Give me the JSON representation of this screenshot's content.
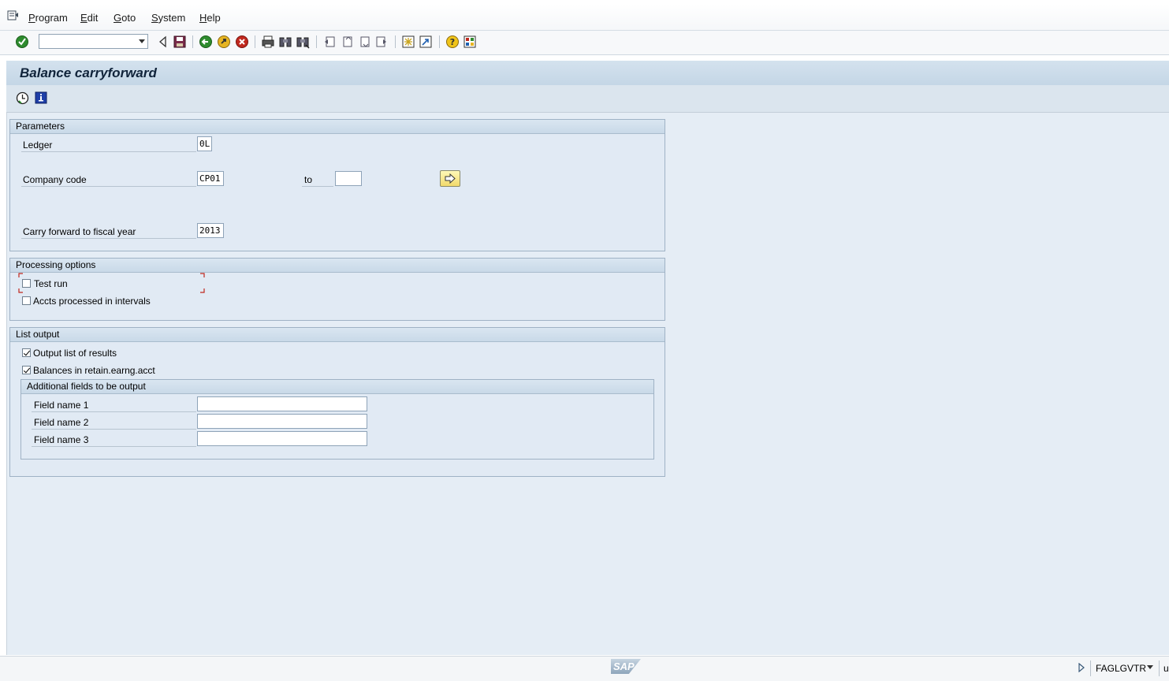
{
  "menu": {
    "items": [
      "Program",
      "Edit",
      "Goto",
      "System",
      "Help"
    ]
  },
  "toolbar": {
    "command_field_value": ""
  },
  "page": {
    "title": "Balance carryforward"
  },
  "parameters": {
    "title": "Parameters",
    "ledger_label": "Ledger",
    "ledger_value": "0L",
    "company_code_label": "Company code",
    "company_code_value": "CP01",
    "to_label": "to",
    "company_code_to_value": "",
    "fiscal_year_label": "Carry forward to fiscal year",
    "fiscal_year_value": "2013"
  },
  "processing": {
    "title": "Processing options",
    "test_run_label": "Test run",
    "test_run_checked": false,
    "accts_intervals_label": "Accts processed in intervals",
    "accts_intervals_checked": false
  },
  "list_output": {
    "title": "List output",
    "output_list_label": "Output list of results",
    "output_list_checked": true,
    "balances_label": "Balances in retain.earng.acct",
    "balances_checked": true,
    "additional": {
      "title": "Additional fields to be output",
      "field1_label": "Field name 1",
      "field1_value": "",
      "field2_label": "Field name 2",
      "field2_value": "",
      "field3_label": "Field name 3",
      "field3_value": ""
    }
  },
  "status": {
    "transaction": "FAGLGVTR",
    "extra": "u"
  },
  "logo_text": "SAP",
  "colors": {
    "background": "#e5edf5",
    "frame_header": "#c9d9e8",
    "ok_icon": "#2e8b2e",
    "cancel_icon": "#c0281e"
  }
}
